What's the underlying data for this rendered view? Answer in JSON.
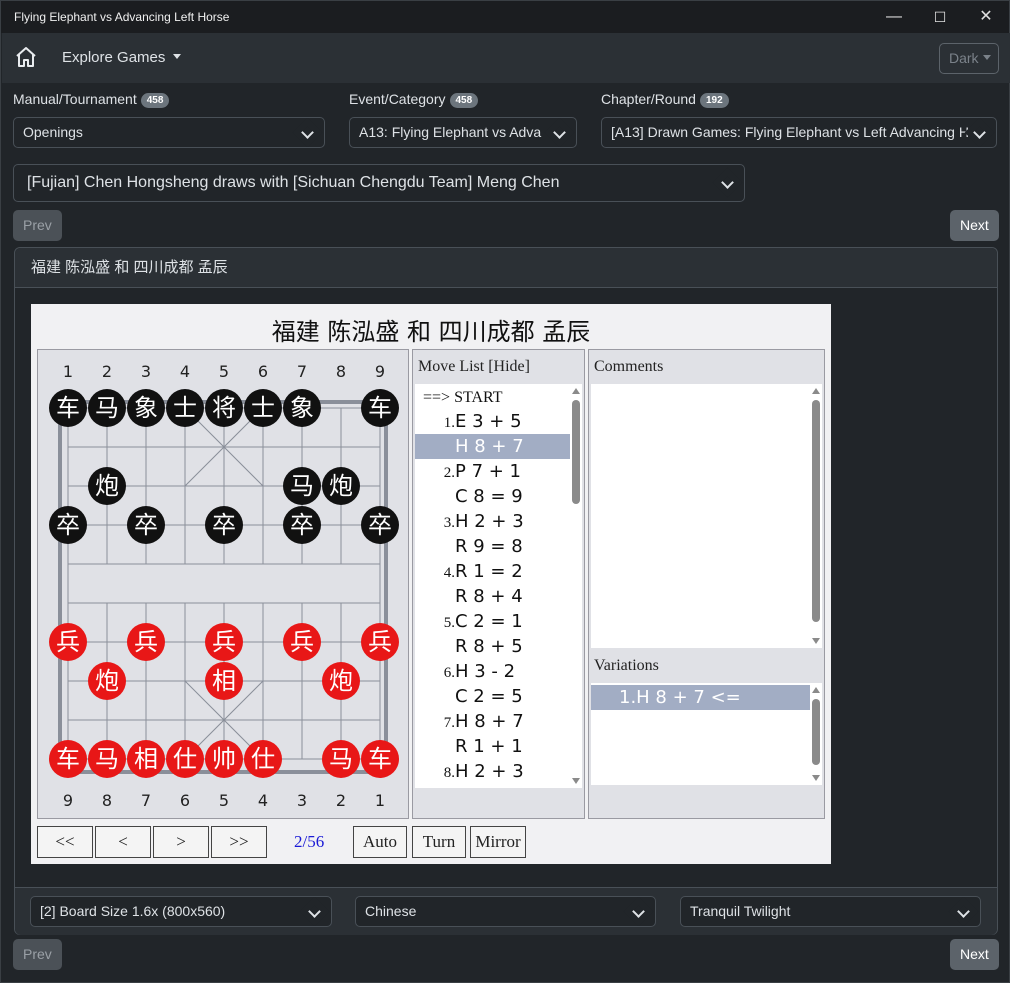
{
  "window": {
    "title": "Flying Elephant vs Advancing Left Horse",
    "min": "—",
    "max": "☐",
    "close": "✕"
  },
  "navbar": {
    "home_icon": "home-icon",
    "explore_label": "Explore Games",
    "theme_label": "Dark"
  },
  "filters": {
    "manual": {
      "label": "Manual/Tournament",
      "count": "458",
      "value": "Openings"
    },
    "event": {
      "label": "Event/Category",
      "count": "458",
      "value": "A13: Flying Elephant vs Adva"
    },
    "chapter": {
      "label": "Chapter/Round",
      "count": "192",
      "value": "[A13] Drawn Games: Flying Elephant vs Left Advancing H"
    },
    "game": {
      "value": "[Fujian] Chen Hongsheng draws with [Sichuan Chengdu Team] Meng Chen"
    }
  },
  "nav_buttons": {
    "prev": "Prev",
    "next": "Next"
  },
  "card": {
    "header": "福建 陈泓盛 和 四川成都 孟辰"
  },
  "board": {
    "title": "福建 陈泓盛 和 四川成都 孟辰",
    "top_files": [
      "1",
      "2",
      "3",
      "4",
      "5",
      "6",
      "7",
      "8",
      "9"
    ],
    "bottom_files": [
      "9",
      "8",
      "7",
      "6",
      "5",
      "4",
      "3",
      "2",
      "1"
    ],
    "pieces": [
      {
        "c": "b",
        "t": "车",
        "f": 0,
        "r": 0
      },
      {
        "c": "b",
        "t": "马",
        "f": 1,
        "r": 0
      },
      {
        "c": "b",
        "t": "象",
        "f": 2,
        "r": 0
      },
      {
        "c": "b",
        "t": "士",
        "f": 3,
        "r": 0
      },
      {
        "c": "b",
        "t": "将",
        "f": 4,
        "r": 0
      },
      {
        "c": "b",
        "t": "士",
        "f": 5,
        "r": 0
      },
      {
        "c": "b",
        "t": "象",
        "f": 6,
        "r": 0
      },
      {
        "c": "b",
        "t": "车",
        "f": 8,
        "r": 0
      },
      {
        "c": "b",
        "t": "炮",
        "f": 1,
        "r": 2
      },
      {
        "c": "b",
        "t": "马",
        "f": 6,
        "r": 2
      },
      {
        "c": "b",
        "t": "炮",
        "f": 7,
        "r": 2
      },
      {
        "c": "b",
        "t": "卒",
        "f": 0,
        "r": 3
      },
      {
        "c": "b",
        "t": "卒",
        "f": 2,
        "r": 3
      },
      {
        "c": "b",
        "t": "卒",
        "f": 4,
        "r": 3
      },
      {
        "c": "b",
        "t": "卒",
        "f": 6,
        "r": 3
      },
      {
        "c": "b",
        "t": "卒",
        "f": 8,
        "r": 3
      },
      {
        "c": "r",
        "t": "兵",
        "f": 0,
        "r": 6
      },
      {
        "c": "r",
        "t": "兵",
        "f": 2,
        "r": 6
      },
      {
        "c": "r",
        "t": "兵",
        "f": 4,
        "r": 6
      },
      {
        "c": "r",
        "t": "兵",
        "f": 6,
        "r": 6
      },
      {
        "c": "r",
        "t": "兵",
        "f": 8,
        "r": 6
      },
      {
        "c": "r",
        "t": "炮",
        "f": 1,
        "r": 7
      },
      {
        "c": "r",
        "t": "相",
        "f": 4,
        "r": 7
      },
      {
        "c": "r",
        "t": "炮",
        "f": 7,
        "r": 7
      },
      {
        "c": "r",
        "t": "车",
        "f": 0,
        "r": 9
      },
      {
        "c": "r",
        "t": "马",
        "f": 1,
        "r": 9
      },
      {
        "c": "r",
        "t": "相",
        "f": 2,
        "r": 9
      },
      {
        "c": "r",
        "t": "仕",
        "f": 3,
        "r": 9
      },
      {
        "c": "r",
        "t": "帅",
        "f": 4,
        "r": 9
      },
      {
        "c": "r",
        "t": "仕",
        "f": 5,
        "r": 9
      },
      {
        "c": "r",
        "t": "马",
        "f": 7,
        "r": 9
      },
      {
        "c": "r",
        "t": "车",
        "f": 8,
        "r": 9
      }
    ]
  },
  "move_list": {
    "header": "Move List [Hide]",
    "moves": [
      {
        "n": "",
        "m": "==> START",
        "start": true
      },
      {
        "n": "1.",
        "m": "E 3 + 5"
      },
      {
        "n": "",
        "m": "H 8 + 7",
        "selected": true
      },
      {
        "n": "2.",
        "m": "P 7 + 1"
      },
      {
        "n": "",
        "m": "C 8 = 9"
      },
      {
        "n": "3.",
        "m": "H 2 + 3"
      },
      {
        "n": "",
        "m": "R 9 = 8"
      },
      {
        "n": "4.",
        "m": "R 1 = 2"
      },
      {
        "n": "",
        "m": "R 8 + 4"
      },
      {
        "n": "5.",
        "m": "C 2 = 1"
      },
      {
        "n": "",
        "m": "R 8 + 5"
      },
      {
        "n": "6.",
        "m": "H 3 - 2"
      },
      {
        "n": "",
        "m": "C 2 = 5"
      },
      {
        "n": "7.",
        "m": "H 8 + 7"
      },
      {
        "n": "",
        "m": "R 1 + 1"
      },
      {
        "n": "8.",
        "m": "H 2 + 3"
      }
    ]
  },
  "comments": {
    "header": "Comments",
    "variations_header": "Variations",
    "variation_line": "1.H 8 + 7     <="
  },
  "controls": {
    "first": "<<",
    "prev": "<",
    "next": ">",
    "last": ">>",
    "counter": "2/56",
    "auto": "Auto",
    "turn": "Turn",
    "mirror": "Mirror"
  },
  "footer": {
    "board_size": "[2] Board Size 1.6x (800x560)",
    "language": "Chinese",
    "theme": "Tranquil Twilight"
  },
  "colors": {
    "bg": "#212529",
    "panel": "#2b3035",
    "red_piece": "#e81717",
    "black_piece": "#111111",
    "selection": "#a2adc4"
  }
}
